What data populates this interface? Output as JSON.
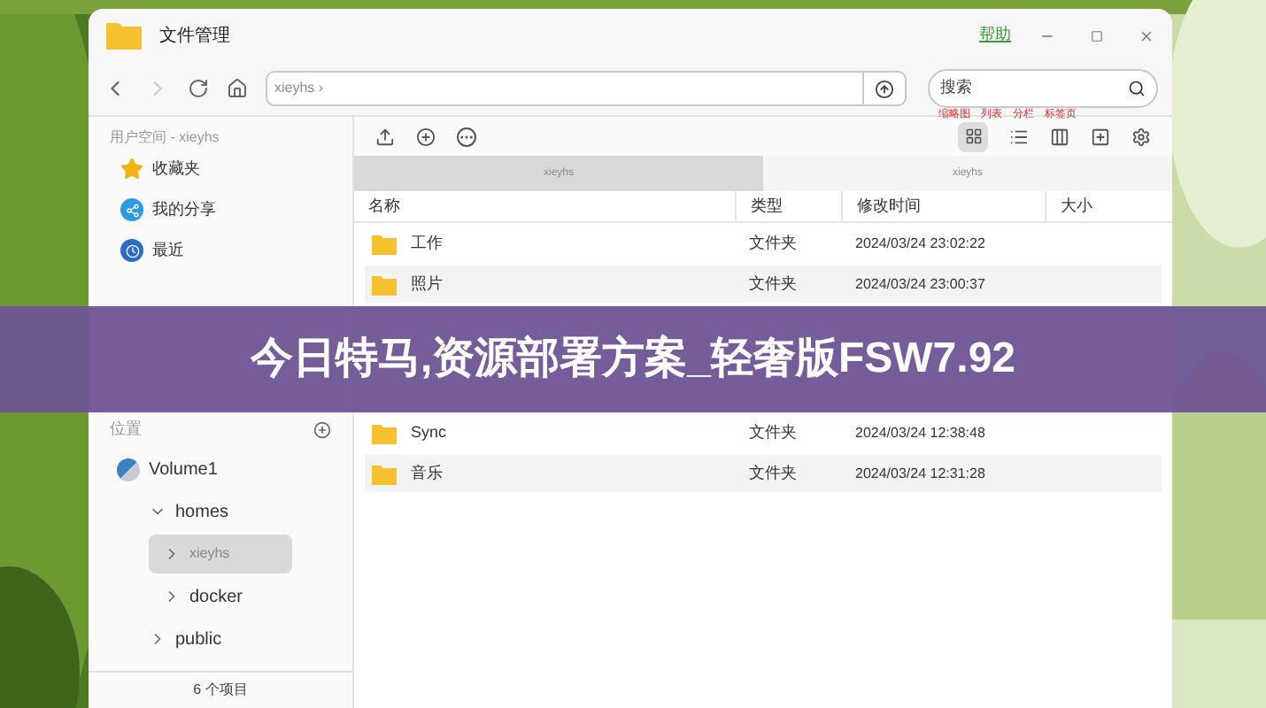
{
  "window": {
    "title": "文件管理",
    "help_link": "帮助"
  },
  "toolbar": {
    "path": "xieyhs",
    "path_separator": "›",
    "search": {
      "placeholder": "搜索"
    },
    "view_hints": [
      "缩略图",
      "列表",
      "分栏",
      "标签页"
    ]
  },
  "sidebar": {
    "user_section": "用户空间 - xieyhs",
    "items": [
      {
        "label": "收藏夹",
        "kind": "star"
      },
      {
        "label": "我的分享",
        "kind": "share"
      },
      {
        "label": "最近",
        "kind": "recent"
      }
    ],
    "location_section": "位置",
    "tree": [
      {
        "label": "Volume1",
        "kind": "volume",
        "selected": false,
        "children": [
          {
            "label": "homes",
            "expanded": true,
            "selected": false,
            "children": [
              {
                "label": "xieyhs",
                "expanded": false,
                "selected": true
              },
              {
                "label": "docker",
                "expanded": false,
                "selected": false
              }
            ]
          },
          {
            "label": "public",
            "expanded": false,
            "selected": false
          }
        ]
      }
    ],
    "footer": "6 个项目"
  },
  "tabs": [
    {
      "label": "xieyhs",
      "selected": true
    },
    {
      "label": "xieyhs",
      "selected": false
    }
  ],
  "table": {
    "columns": [
      "名称",
      "类型",
      "修改时间",
      "大小"
    ],
    "rows": [
      {
        "name": "工作",
        "type": "文件夹",
        "modified": "2024/03/24 23:02:22"
      },
      {
        "name": "照片",
        "type": "文件夹",
        "modified": "2024/03/24 23:00:37"
      },
      {
        "name": "Sync",
        "type": "文件夹",
        "modified": "2024/03/24 12:38:48"
      },
      {
        "name": "音乐",
        "type": "文件夹",
        "modified": "2024/03/24 12:31:28"
      }
    ]
  },
  "overlay_banner": "今日特马,资源部署方案_轻奢版FSW7.92"
}
